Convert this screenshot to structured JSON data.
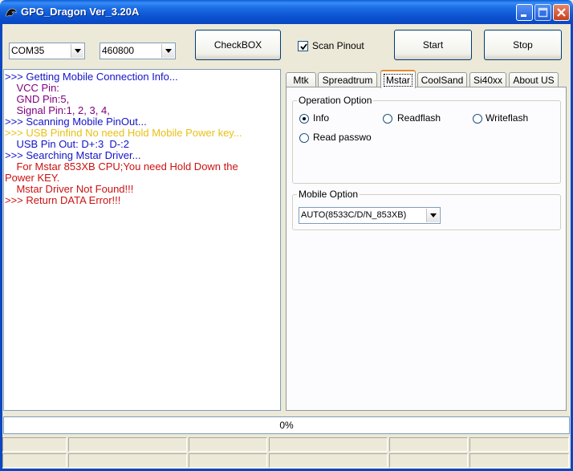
{
  "window": {
    "title": "GPG_Dragon  Ver_3.20A"
  },
  "toolbar": {
    "port": "COM35",
    "baud": "460800",
    "checkbox_label": "CheckBOX",
    "scan_pinout_label": "Scan Pinout",
    "scan_pinout_checked": true,
    "start_label": "Start",
    "stop_label": "Stop"
  },
  "log": {
    "lines": [
      {
        "text": ">>> Getting Mobile Connection Info...",
        "color": "#1414c8"
      },
      {
        "text": "    VCC Pin:",
        "color": "#800080"
      },
      {
        "text": "    GND Pin:5,",
        "color": "#800080"
      },
      {
        "text": "    Signal Pin:1, 2, 3, 4,",
        "color": "#800080"
      },
      {
        "text": ">>> Scanning Mobile PinOut...",
        "color": "#1414c8"
      },
      {
        "text": ">>> USB Pinfind No need Hold Mobile Power key...",
        "color": "#e8c014"
      },
      {
        "text": "    USB Pin Out: D+:3  D-:2",
        "color": "#1414c8"
      },
      {
        "text": ">>> Searching Mstar Driver...",
        "color": "#1414c8"
      },
      {
        "text": "    For Mstar 853XB CPU;You need Hold Down the",
        "color": "#cc1111"
      },
      {
        "text": "Power KEY.",
        "color": "#cc1111"
      },
      {
        "text": "    Mstar Driver Not Found!!!",
        "color": "#cc1111"
      },
      {
        "text": ">>> Return DATA Error!!!",
        "color": "#cc1111"
      }
    ]
  },
  "tabs": [
    {
      "label": "Mtk"
    },
    {
      "label": "Spreadtrum"
    },
    {
      "label": "Mstar"
    },
    {
      "label": "CoolSand"
    },
    {
      "label": "Si40xx"
    },
    {
      "label": "About US"
    }
  ],
  "active_tab": "Mstar",
  "operation_option": {
    "title": "Operation Option",
    "options": [
      {
        "label": "Info",
        "selected": true
      },
      {
        "label": "Readflash",
        "selected": false
      },
      {
        "label": "Writeflash",
        "selected": false
      },
      {
        "label": "Read passwo",
        "selected": false
      }
    ]
  },
  "mobile_option": {
    "title": "Mobile Option",
    "selected": "AUTO(8533C/D/N_853XB)"
  },
  "progress": {
    "value": 0,
    "label": "0%"
  },
  "colors": {
    "titlebar": "#0a47c0",
    "face": "#ece9d8",
    "tab_highlight": "#e68b2c"
  }
}
